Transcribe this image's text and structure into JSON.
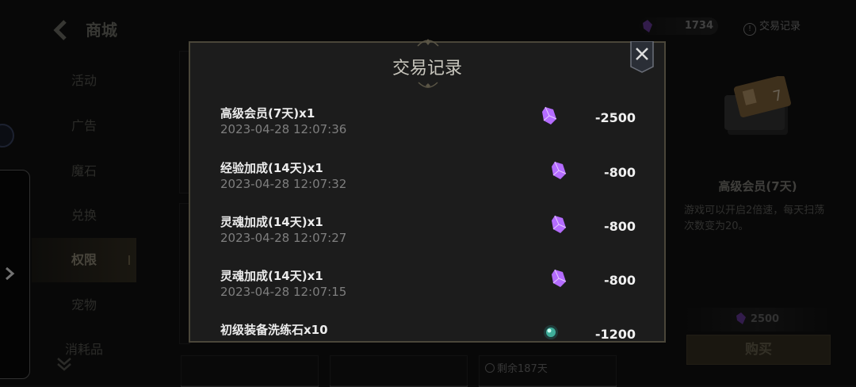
{
  "header": {
    "title": "商城"
  },
  "sidebar": {
    "items": [
      {
        "label": "活动"
      },
      {
        "label": "广告"
      },
      {
        "label": "魔石"
      },
      {
        "label": "兑换"
      },
      {
        "label": "权限"
      },
      {
        "label": "宠物"
      },
      {
        "label": "消耗品"
      }
    ],
    "active_index": 4
  },
  "topbar": {
    "currency_amount": "1734",
    "trade_record_label": "交易记录"
  },
  "background_card": {
    "remaining": "剩余187天"
  },
  "product": {
    "title": "高级会员(7天)",
    "description": "游戏可以开启2倍速，每天扫荡次数变为20。",
    "price": "2500",
    "buy_label": "购买"
  },
  "modal": {
    "title": "交易记录",
    "records": [
      {
        "name": "高级会员(7天)x1",
        "time": "2023-04-28 12:07:36",
        "amount": "-2500",
        "icon": "purple-gem-icon"
      },
      {
        "name": "经验加成(14天)x1",
        "time": "2023-04-28 12:07:32",
        "amount": "-800",
        "icon": "purple-gem-icon"
      },
      {
        "name": "灵魂加成(14天)x1",
        "time": "2023-04-28 12:07:27",
        "amount": "-800",
        "icon": "purple-gem-icon"
      },
      {
        "name": "灵魂加成(14天)x1",
        "time": "2023-04-28 12:07:15",
        "amount": "-800",
        "icon": "purple-gem-icon"
      },
      {
        "name": "初级装备洗练石x10",
        "time": "",
        "amount": "-1200",
        "icon": "green-stone-icon"
      }
    ]
  },
  "colors": {
    "gem_purple": "#b46cff",
    "modal_border": "#4a4639",
    "buy_button": "#3b3424"
  }
}
